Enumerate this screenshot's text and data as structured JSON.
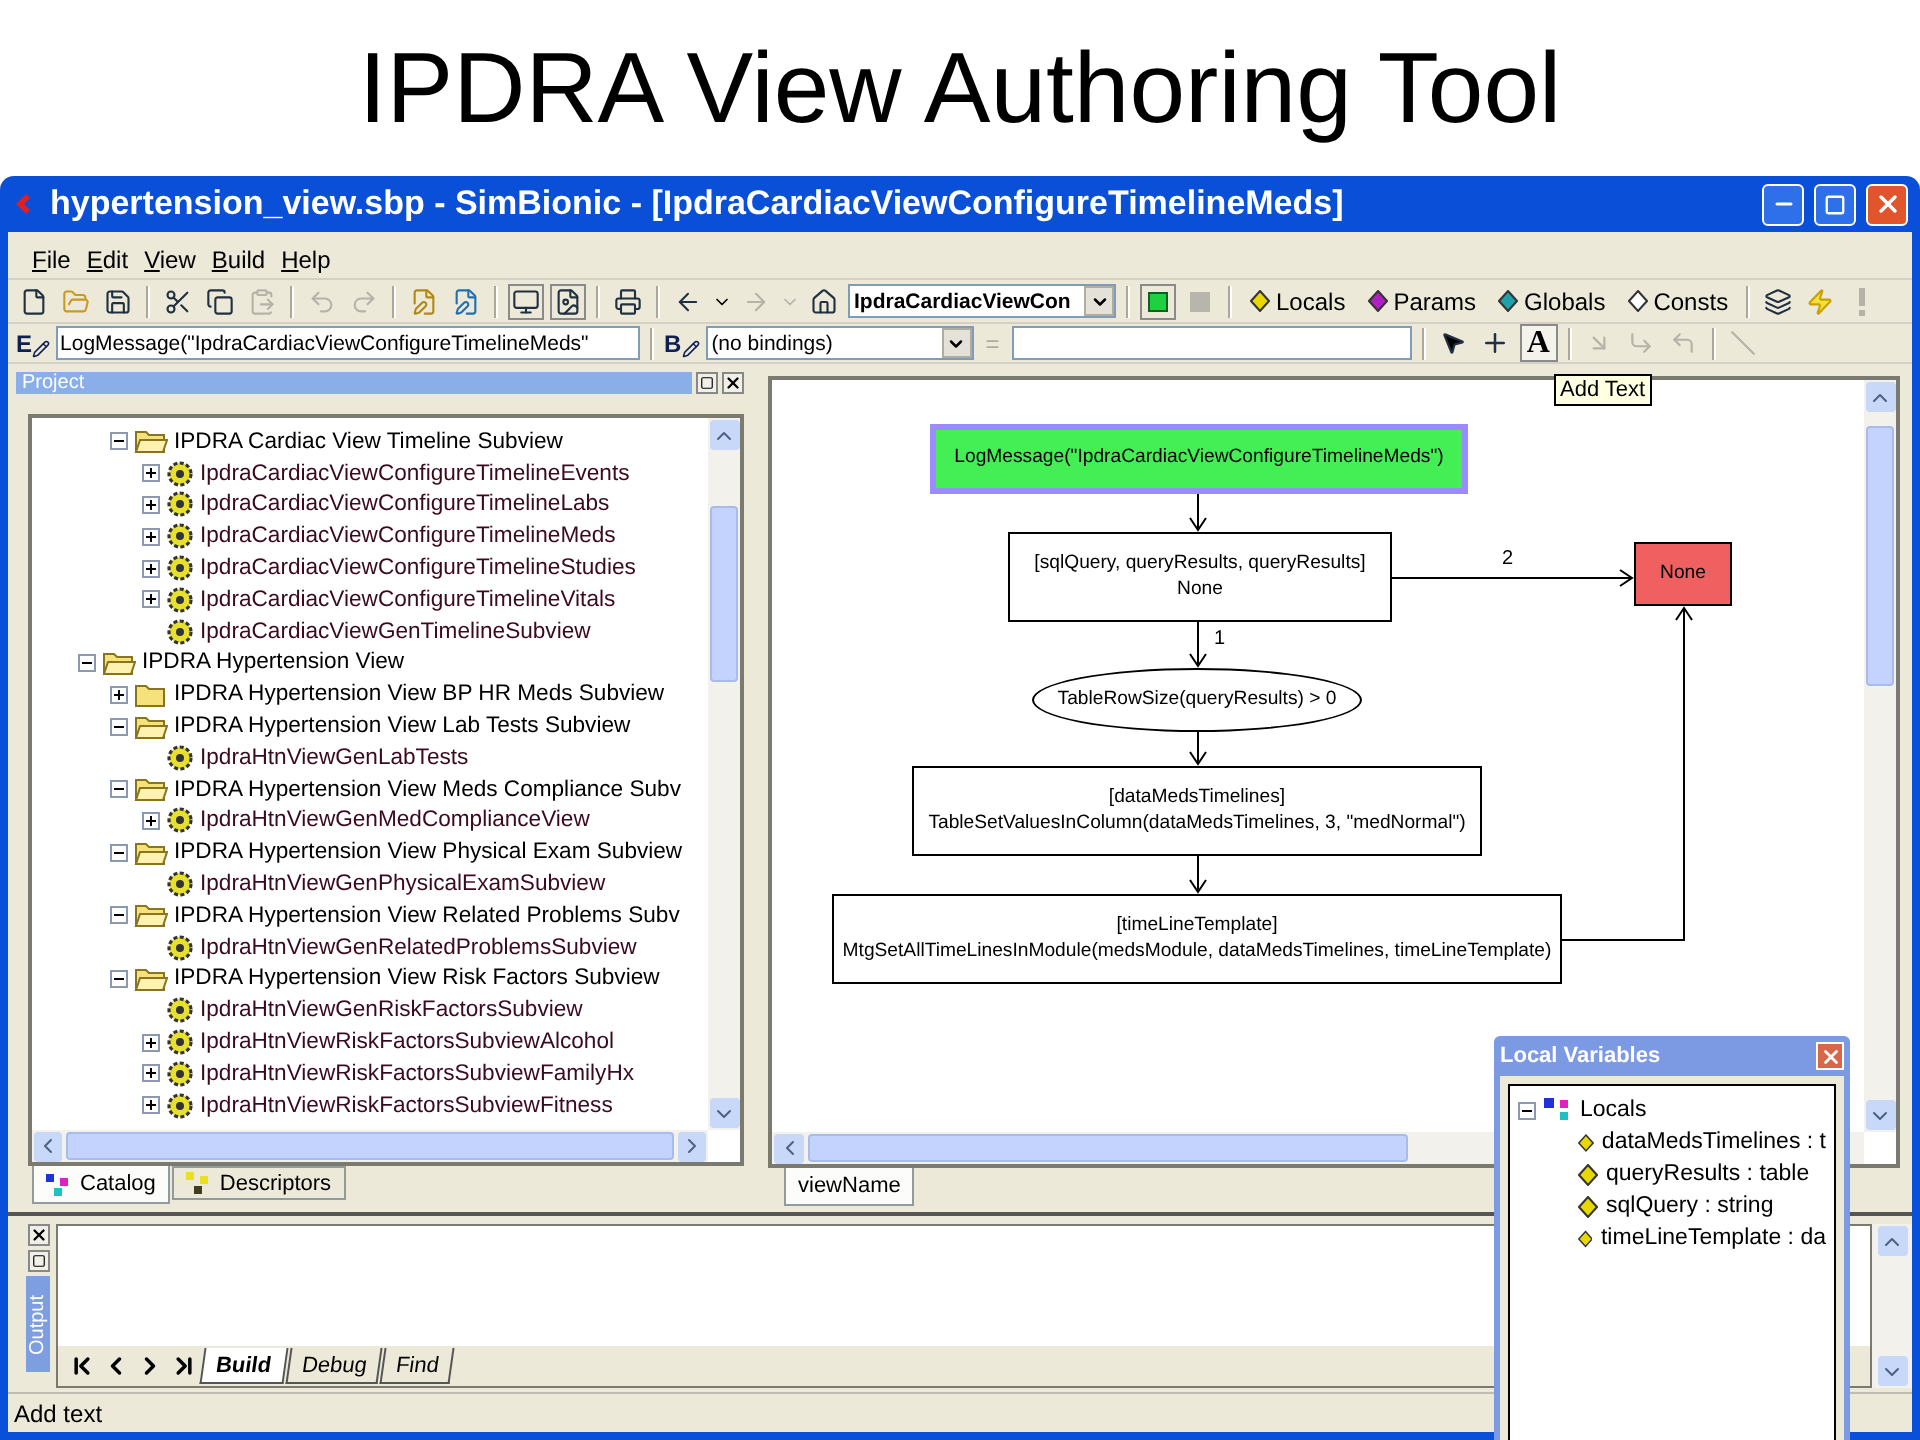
{
  "slide_title": "IPDRA View Authoring Tool",
  "window": {
    "title": "hypertension_view.sbp - SimBionic - [IpdraCardiacViewConfigureTimelineMeds]"
  },
  "menu": [
    "File",
    "Edit",
    "View",
    "Build",
    "Help"
  ],
  "toolbar": {
    "behavior_select": "IpdraCardiacViewCon",
    "variable_buttons": [
      {
        "label": "Locals",
        "color": "#e8d800"
      },
      {
        "label": "Params",
        "color": "#b020c0"
      },
      {
        "label": "Globals",
        "color": "#20a0a8"
      },
      {
        "label": "Consts",
        "color": "#ffffff"
      }
    ]
  },
  "expression_bar": {
    "expression_letter": "E",
    "expression": "LogMessage(\"IpdraCardiacViewConfigureTimelineMeds\"",
    "binding_letter": "B",
    "bindings": "(no bindings)",
    "equals": "=",
    "text_tool": "A"
  },
  "tooltip": "Add Text",
  "project_panel": {
    "title": "Project",
    "tree_scrolled_branch": [
      {
        "label": "IPDRA Cardiac View Timeline Subview",
        "kind": "folder",
        "expanded": true,
        "children": [
          {
            "label": "IpdraCardiacViewConfigureTimelineEvents",
            "kind": "behavior",
            "expanded": false
          },
          {
            "label": "IpdraCardiacViewConfigureTimelineLabs",
            "kind": "behavior",
            "expanded": false
          },
          {
            "label": "IpdraCardiacViewConfigureTimelineMeds",
            "kind": "behavior",
            "expanded": false
          },
          {
            "label": "IpdraCardiacViewConfigureTimelineStudies",
            "kind": "behavior",
            "expanded": false
          },
          {
            "label": "IpdraCardiacViewConfigureTimelineVitals",
            "kind": "behavior",
            "expanded": false
          },
          {
            "label": "IpdraCardiacViewGenTimelineSubview",
            "kind": "behavior"
          }
        ]
      }
    ],
    "tree": [
      {
        "label": "IPDRA Hypertension View",
        "kind": "folder",
        "expanded": true,
        "children": [
          {
            "label": "IPDRA Hypertension View BP HR Meds Subview",
            "kind": "folder",
            "expanded": false
          },
          {
            "label": "IPDRA Hypertension View Lab Tests Subview",
            "kind": "folder",
            "expanded": true,
            "children": [
              {
                "label": "IpdraHtnViewGenLabTests",
                "kind": "behavior"
              }
            ]
          },
          {
            "label": "IPDRA Hypertension View Meds Compliance Subv",
            "kind": "folder",
            "expanded": true,
            "children": [
              {
                "label": "IpdraHtnViewGenMedComplianceView",
                "kind": "behavior",
                "expanded": false
              }
            ]
          },
          {
            "label": "IPDRA Hypertension View Physical Exam Subview",
            "kind": "folder",
            "expanded": true,
            "children": [
              {
                "label": "IpdraHtnViewGenPhysicalExamSubview",
                "kind": "behavior"
              }
            ]
          },
          {
            "label": "IPDRA Hypertension View Related Problems Subv",
            "kind": "folder",
            "expanded": true,
            "children": [
              {
                "label": "IpdraHtnViewGenRelatedProblemsSubview",
                "kind": "behavior"
              }
            ]
          },
          {
            "label": "IPDRA Hypertension View Risk Factors Subview",
            "kind": "folder",
            "expanded": true,
            "children": [
              {
                "label": "IpdraHtnViewGenRiskFactorsSubview",
                "kind": "behavior"
              },
              {
                "label": "IpdraHtnViewRiskFactorsSubviewAlcohol",
                "kind": "behavior",
                "expanded": false
              },
              {
                "label": "IpdraHtnViewRiskFactorsSubviewFamilyHx",
                "kind": "behavior",
                "expanded": false
              },
              {
                "label": "IpdraHtnViewRiskFactorsSubviewFitness",
                "kind": "behavior",
                "expanded": false
              }
            ]
          }
        ]
      }
    ],
    "tabs": [
      {
        "label": "Catalog",
        "selected": true
      },
      {
        "label": "Descriptors",
        "selected": false
      }
    ]
  },
  "canvas": {
    "nodes": [
      {
        "kind": "action",
        "color": "#44ee55",
        "selected": true,
        "lines": [
          "LogMessage(\"IpdraCardiacViewConfigureTimelineMeds\")"
        ]
      },
      {
        "kind": "action",
        "color": "#ffffff",
        "selected": false,
        "lines": [
          "[sqlQuery, queryResults, queryResults]",
          "None"
        ]
      },
      {
        "kind": "terminal",
        "color": "#f06060",
        "selected": false,
        "lines": [
          "None"
        ]
      },
      {
        "kind": "condition",
        "color": "#ffffff",
        "selected": false,
        "lines": [
          "TableRowSize(queryResults) > 0"
        ]
      },
      {
        "kind": "action",
        "color": "#ffffff",
        "selected": false,
        "lines": [
          "[dataMedsTimelines]",
          "TableSetValuesInColumn(dataMedsTimelines, 3, \"medNormal\")"
        ]
      },
      {
        "kind": "action",
        "color": "#ffffff",
        "selected": false,
        "lines": [
          "[timeLineTemplate]",
          "MtgSetAllTimeLinesInModule(medsModule, dataMedsTimelines, timeLineTemplate)"
        ]
      }
    ],
    "branch_labels": [
      "1",
      "2"
    ],
    "tabs": [
      {
        "label": "viewName",
        "selected": true
      }
    ]
  },
  "output": {
    "title": "Output",
    "tabs": [
      {
        "label": "Build",
        "selected": true
      },
      {
        "label": "Debug",
        "selected": false
      },
      {
        "label": "Find",
        "selected": false
      }
    ]
  },
  "status_bar": "Add text",
  "local_variables": {
    "title": "Local Variables",
    "root": {
      "label": "Locals",
      "expanded": true,
      "children": [
        {
          "label": "dataMedsTimelines : t"
        },
        {
          "label": "queryResults : table"
        },
        {
          "label": "sqlQuery : string"
        },
        {
          "label": "timeLineTemplate : da"
        }
      ]
    }
  }
}
